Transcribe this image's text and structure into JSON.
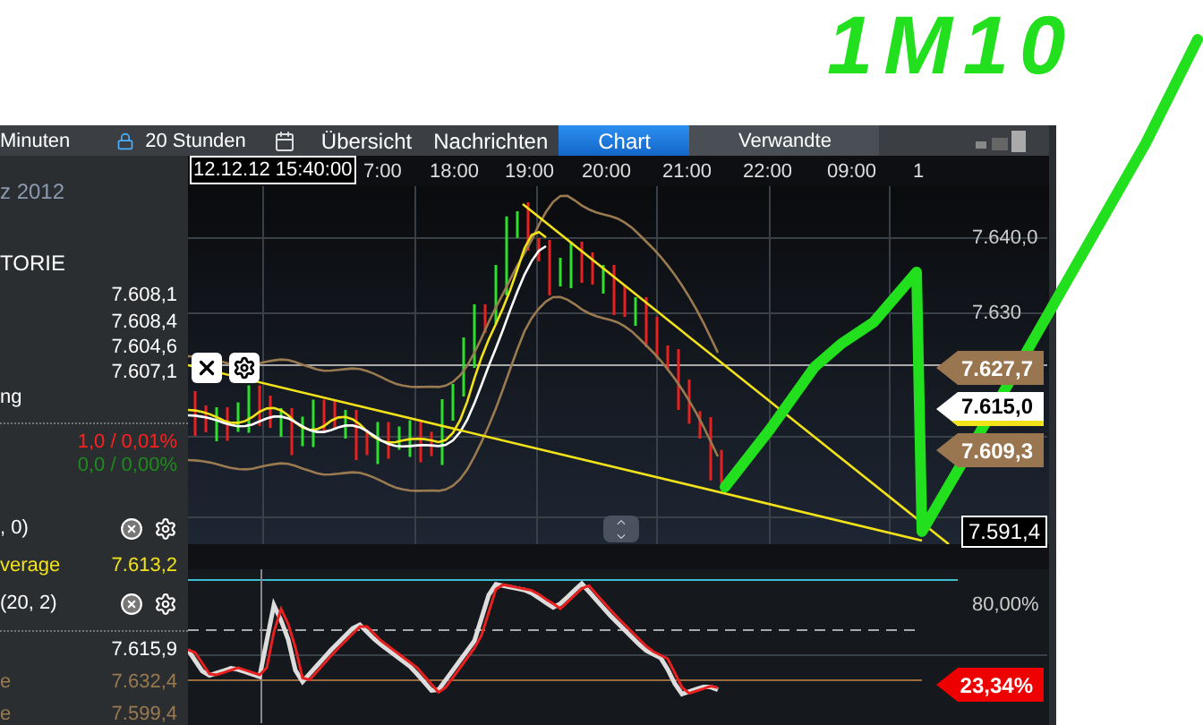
{
  "annotation": {
    "handwriting": "1M10"
  },
  "header": {
    "interval": "Minuten",
    "range": "20 Stunden",
    "tabs": [
      {
        "label": "Übersicht",
        "selected": false
      },
      {
        "label": "Nachrichten",
        "selected": false
      },
      {
        "label": "Chart",
        "selected": true
      },
      {
        "label": "Verwandte",
        "selected": false
      }
    ]
  },
  "sidebar": {
    "items": [
      {
        "kind": "date",
        "label": "z 2012"
      },
      {
        "kind": "heading",
        "label": "TORIE"
      },
      {
        "kind": "value",
        "value": "7.608,1"
      },
      {
        "kind": "value",
        "value": "7.608,4"
      },
      {
        "kind": "value",
        "value": "7.604,6"
      },
      {
        "kind": "value",
        "value": "7.607,1"
      },
      {
        "kind": "label",
        "label": "ng"
      },
      {
        "kind": "change",
        "value": "1,0 / 0,01%",
        "color": "#ff2020"
      },
      {
        "kind": "change",
        "value": "0,0 / 0,00%",
        "color": "#1e8a1e"
      },
      {
        "kind": "indicator",
        "label": ", 0)"
      },
      {
        "kind": "value",
        "label": "verage",
        "value": "7.613,2",
        "color": "#f2e21a"
      },
      {
        "kind": "indicator",
        "label": "(20, 2)"
      },
      {
        "kind": "value",
        "value": "7.615,9"
      },
      {
        "kind": "value",
        "label": "e",
        "value": "7.632,4",
        "color": "#9a7a50"
      },
      {
        "kind": "value",
        "label": "e",
        "value": "7.599,4",
        "color": "#9a7a50"
      }
    ]
  },
  "chart": {
    "cursor_time": "12.12.12 15:40:00",
    "time_labels": [
      "7:00",
      "18:00",
      "19:00",
      "20:00",
      "21:00",
      "22:00",
      "09:00",
      "1"
    ],
    "price_labels": [
      "7.640,0",
      "7.630"
    ],
    "price_tags": [
      {
        "kind": "band",
        "value": "7.627,7"
      },
      {
        "kind": "current",
        "value": "7.615,0"
      },
      {
        "kind": "band",
        "value": "7.609,3"
      },
      {
        "kind": "cursor",
        "value": "7.591,4"
      }
    ]
  },
  "oscillator": {
    "level_label": "80,00%",
    "tag": "23,34%"
  }
}
